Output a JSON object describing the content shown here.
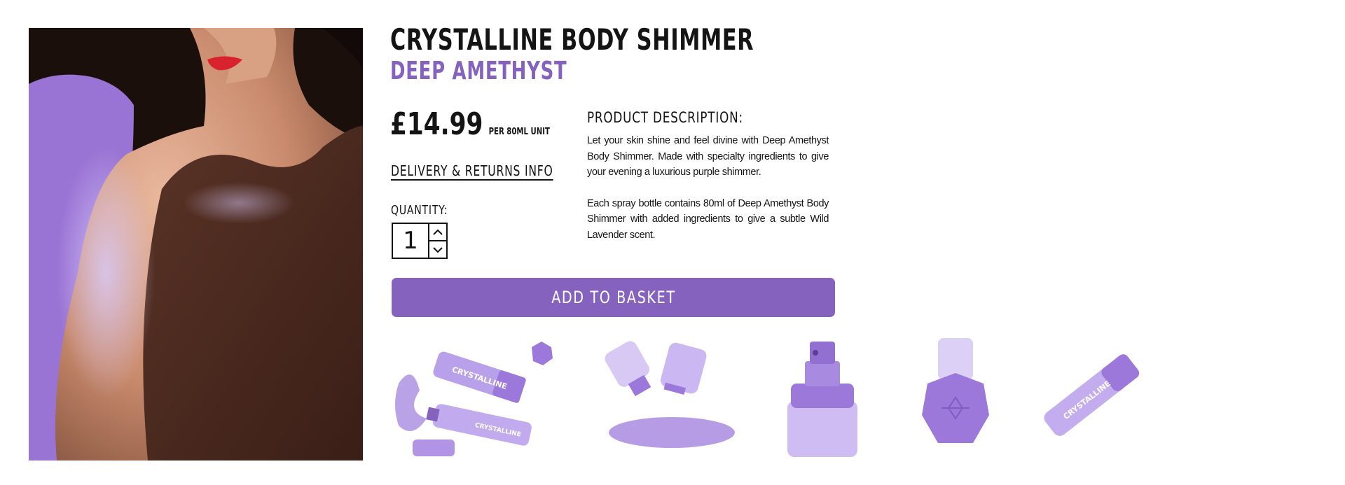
{
  "product": {
    "title": "CRYSTALLINE BODY SHIMMER",
    "shade": "DEEP AMETHYST",
    "price": "£14.99",
    "unit": "PER 80ML UNIT",
    "delivery_link": "DELIVERY & RETURNS INFO",
    "quantity_label": "QUANTITY:",
    "quantity": "1",
    "add_to_basket": "ADD TO BASKET"
  },
  "description": {
    "heading": "PRODUCT DESCRIPTION:",
    "paragraphs": [
      "Let your skin shine and feel divine with Deep Amethyst Body Shimmer. Made with specialty ingredients to give your evening a luxurious purple shimmer.",
      "Each spray bottle contains 80ml of Deep Amethyst Body Shimmer with added ingredients to give a subtle Wild Lavender scent."
    ]
  },
  "images": {
    "hero": "model-shoulder-shimmer",
    "thumbnails": [
      "two-bottles-with-splash",
      "open-bottles-spill",
      "spray-nozzle-closeup",
      "bottle-top-view",
      "single-bottle-angled"
    ],
    "bottle_label": "CRYSTALLINE"
  },
  "colors": {
    "accent": "#8462bd",
    "text": "#141414",
    "background": "#ffffff"
  },
  "icons": {
    "increment": "chevron-up-icon",
    "decrement": "chevron-down-icon"
  }
}
